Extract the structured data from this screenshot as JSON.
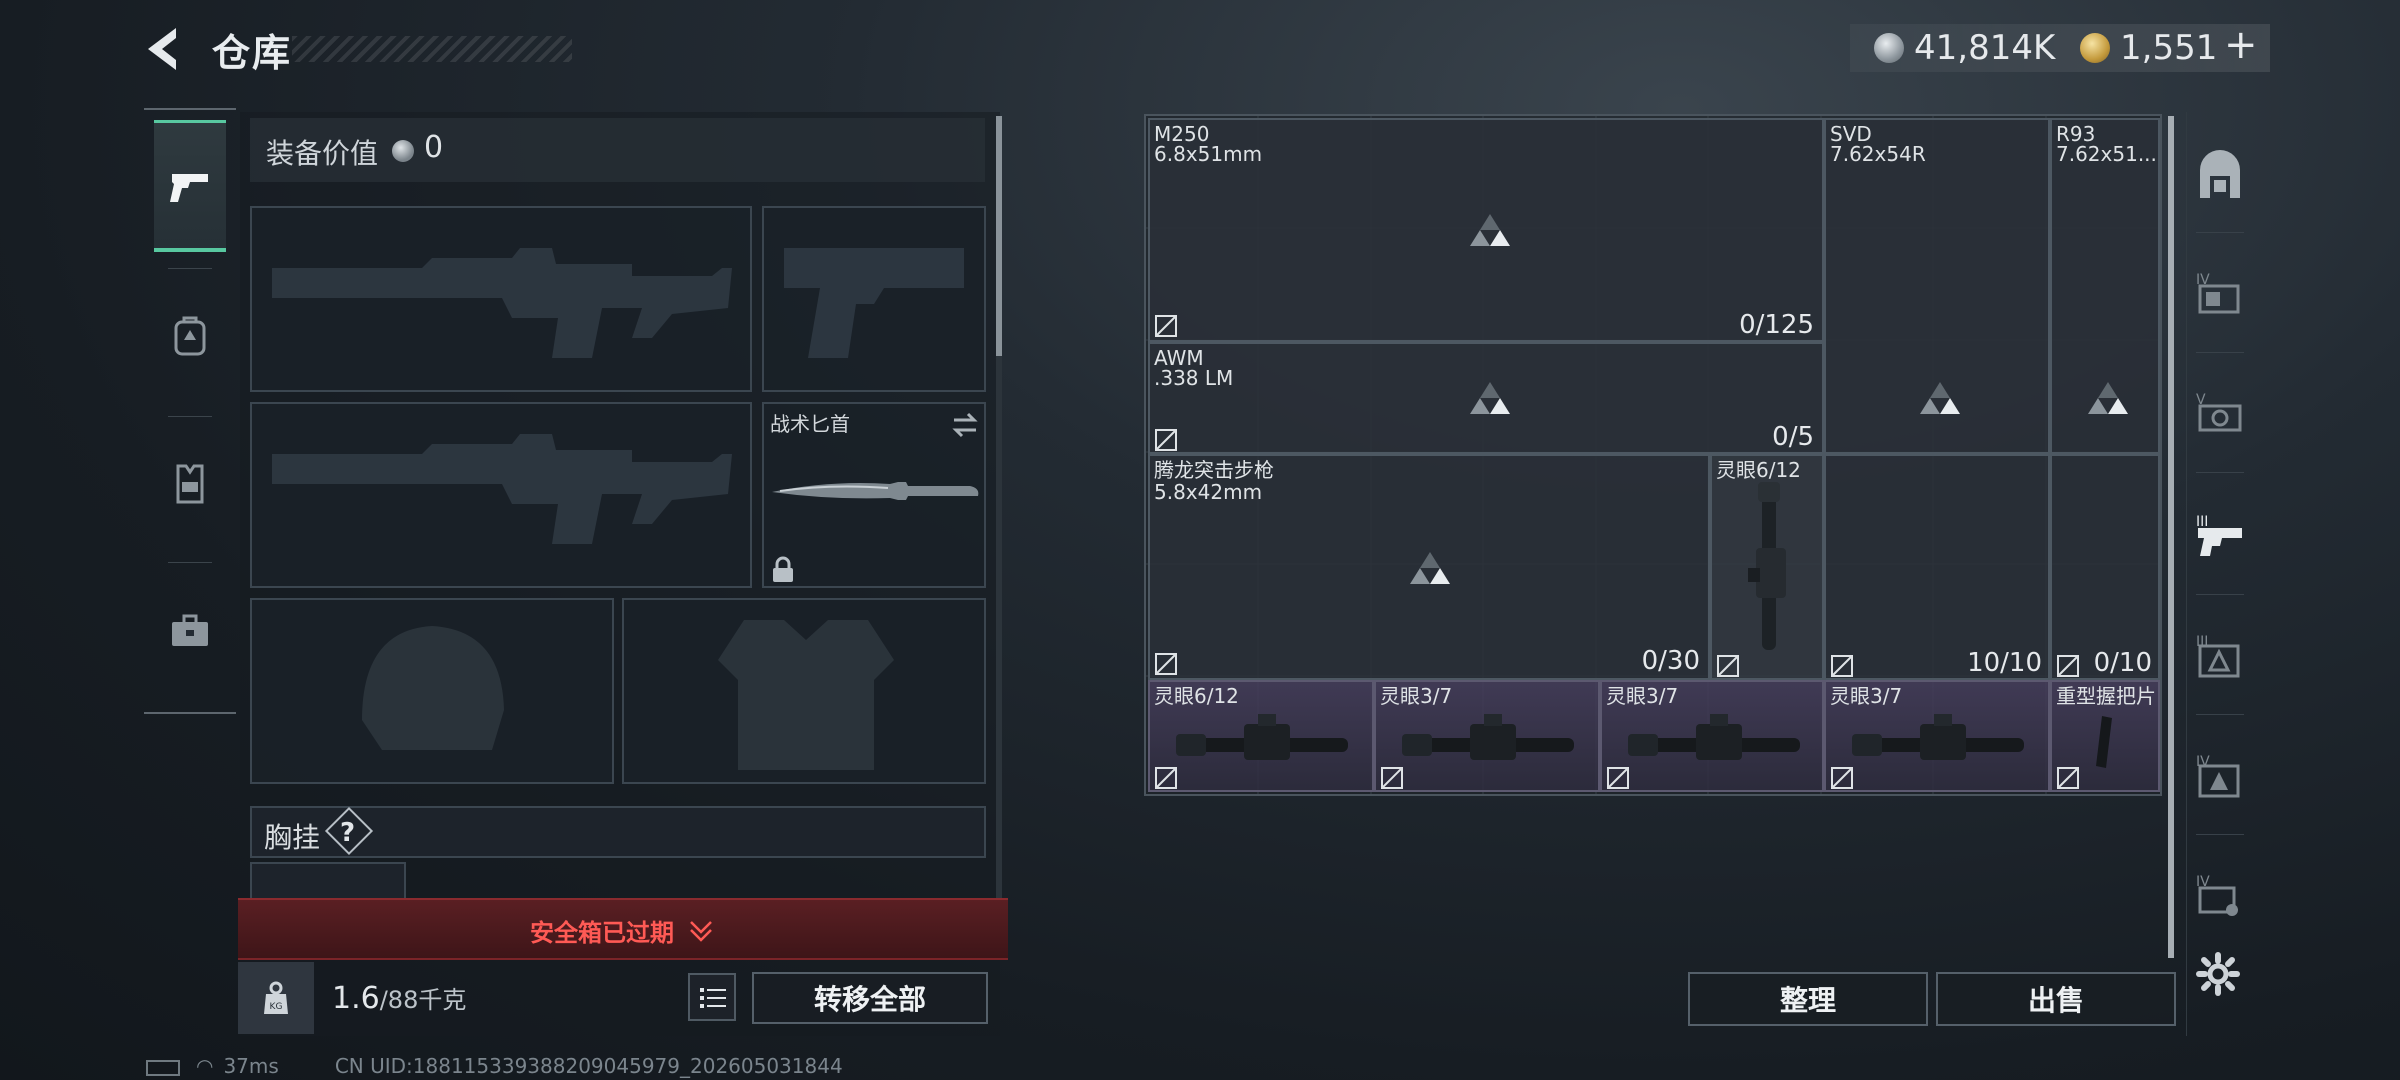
{
  "header": {
    "title": "仓库",
    "currency_silver": "41,814K",
    "currency_gold": "1,551",
    "add_label": "+"
  },
  "left_nav": {
    "items": [
      {
        "name": "weapons",
        "icon": "pistol-icon",
        "active": true
      },
      {
        "name": "backpack",
        "icon": "backpack-icon",
        "active": false
      },
      {
        "name": "vest",
        "icon": "vest-icon",
        "active": false
      },
      {
        "name": "case",
        "icon": "briefcase-icon",
        "active": false
      }
    ]
  },
  "equipment": {
    "value_label": "装备价值",
    "value": "0",
    "knife_label": "战术匕首",
    "chest_rig_label": "胸挂",
    "chest_rig_hint": "?",
    "expired_text": "安全箱已过期",
    "weight_current": "1.6",
    "weight_max": "/88千克",
    "transfer_all": "转移全部"
  },
  "storage": {
    "items": [
      {
        "name": "M250",
        "ammo": "6.8x51mm",
        "count": "0/125"
      },
      {
        "name": "SVD",
        "ammo": "7.62x54R"
      },
      {
        "name": "R93",
        "ammo": "7.62x51..."
      },
      {
        "name": "AWM",
        "ammo": ".338 LM",
        "count": "0/5"
      },
      {
        "name": "腾龙突击步枪",
        "ammo": "5.8x42mm",
        "count": "0/30"
      },
      {
        "name": "灵眼6/12",
        "ammo": ""
      },
      {
        "name": "",
        "count": "10/10"
      },
      {
        "name": "",
        "count": "0/10"
      },
      {
        "name": "灵眼6/12"
      },
      {
        "name": "灵眼3/7"
      },
      {
        "name": "灵眼3/7"
      },
      {
        "name": "灵眼3/7"
      },
      {
        "name": "重型握把片"
      }
    ],
    "organize": "整理",
    "sell": "出售"
  },
  "right_nav": {
    "tiers": [
      "IV",
      "V",
      "III",
      "III",
      "IV",
      "IV"
    ]
  },
  "footer": {
    "ping": "37ms",
    "uid": "CN UID:188115339388209045979_202605031844"
  }
}
